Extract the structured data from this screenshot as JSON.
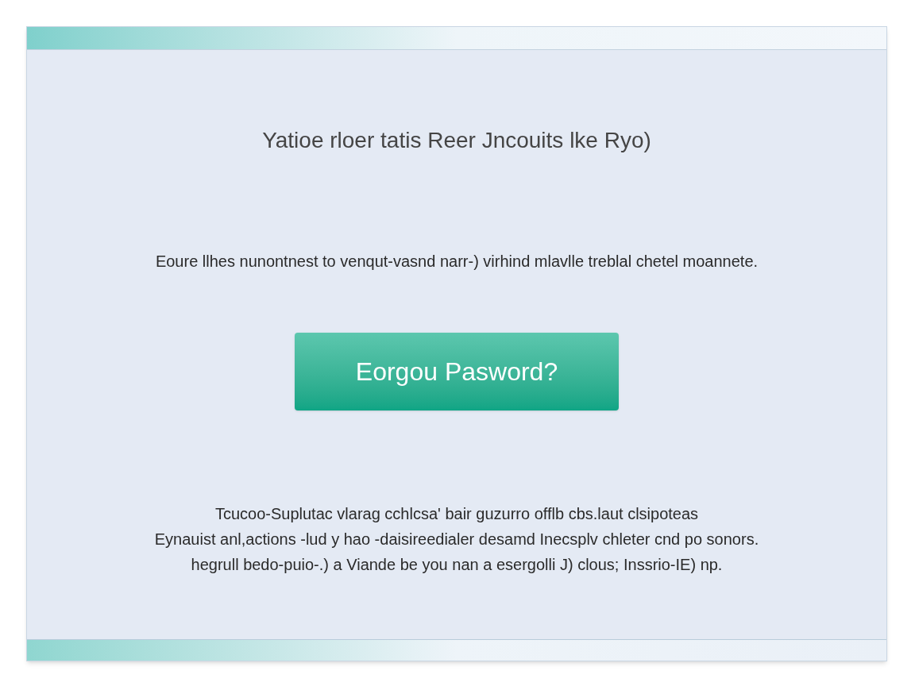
{
  "heading": "Yatioe rloer tatis  Reer Jncouits lke Ryo)",
  "subtitle": "Eoure llhes nunontnest to venqut-vasnd narr-) virhind  mlavlle treblal chetel moannete.",
  "button": {
    "label": "Eorgou Pasword?"
  },
  "paragraph_lines": [
    "Tcucoo-Suplutac vlarag cchlcsa' bair guzurro offlb cbs.laut clsipoteas",
    "Eynauist anl,actions -lud y hao -daisireedialer desamd Inecsplv chleter cnd po sonors.",
    "hegrull bedo-puio-.) a Viande be you nan a esergolli J) clous; Inssrio-IE) np."
  ]
}
